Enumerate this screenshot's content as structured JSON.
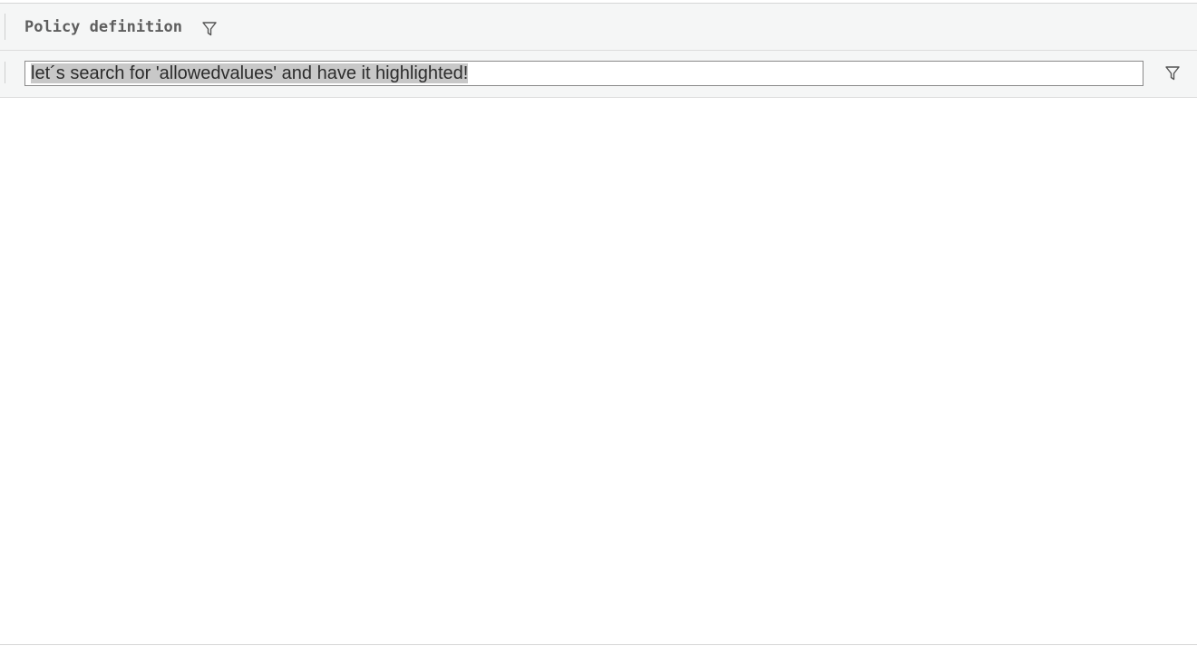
{
  "header": {
    "column_title": "Policy definition",
    "filter_icon": "filter-icon"
  },
  "filter_row": {
    "input_value": "let´s search for 'allowedvalues' and have it highlighted!",
    "filter_icon": "filter-icon"
  },
  "colors": {
    "header_bg": "#f5f6f6",
    "selection_bg": "#c8c8c8",
    "text": "#2c2c2c"
  }
}
